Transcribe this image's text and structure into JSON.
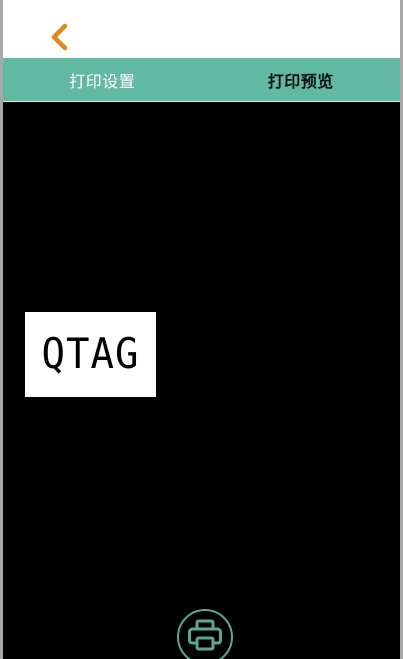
{
  "tabs": [
    {
      "label": "打印设置",
      "active": false
    },
    {
      "label": "打印预览",
      "active": true
    }
  ],
  "preview": {
    "label_text": "QTAG"
  },
  "colors": {
    "accent": "#62b9a2",
    "back_icon": "#e08a1e",
    "print_icon": "#5aa893",
    "preview_bg": "#000000"
  },
  "icons": {
    "back": "chevron-left-icon",
    "print": "printer-icon"
  }
}
